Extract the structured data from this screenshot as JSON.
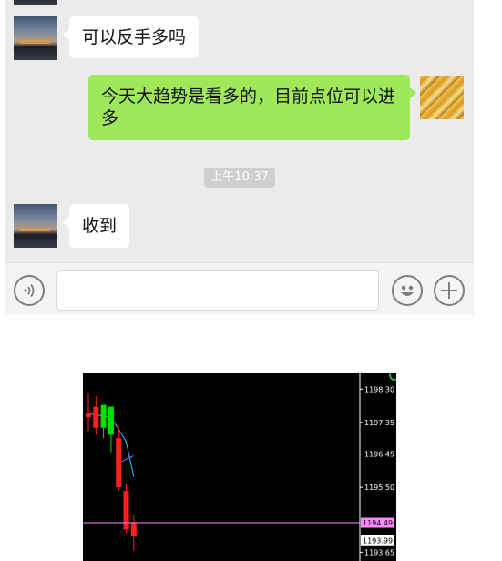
{
  "chat": {
    "messages": [
      {
        "side": "left",
        "text": "可以反手多吗"
      },
      {
        "side": "right",
        "line1": "今天大趋势是看多的，目前点位可以进",
        "line2": "多"
      },
      {
        "side": "left",
        "text": "收到"
      }
    ],
    "timestamp": "上午10:37",
    "input": {
      "value": "",
      "placeholder": ""
    }
  },
  "colors": {
    "chat_bg": "#ebebeb",
    "bubble_me": "#9ee85a",
    "bubble_other": "#ffffff",
    "bull_candle": "#00e000",
    "bear_candle": "#ff1f1f",
    "current_price_line": "#ff88ff"
  },
  "icons": {
    "voice": "voice-icon",
    "emoji": "emoji-icon",
    "plus": "plus-icon"
  },
  "chart_data": {
    "type": "candlestick",
    "y_range": [
      1193.4,
      1198.75
    ],
    "price_ticks": [
      "1198.30",
      "1197.35",
      "1196.45",
      "1195.50",
      "1193.65"
    ],
    "current_price": "1194.49",
    "bid_label": "1193.99",
    "candles": [
      {
        "o": 1197.6,
        "h": 1198.2,
        "l": 1197.1,
        "c": 1197.5
      },
      {
        "o": 1197.8,
        "h": 1198.1,
        "l": 1197.0,
        "c": 1197.2
      },
      {
        "o": 1197.2,
        "h": 1197.7,
        "l": 1196.9,
        "c": 1197.85
      },
      {
        "o": 1197.0,
        "h": 1197.4,
        "l": 1196.5,
        "c": 1197.8
      },
      {
        "o": 1196.9,
        "h": 1197.2,
        "l": 1195.4,
        "c": 1195.5
      },
      {
        "o": 1195.4,
        "h": 1195.6,
        "l": 1194.2,
        "c": 1194.3
      },
      {
        "o": 1194.5,
        "h": 1194.7,
        "l": 1193.7,
        "c": 1194.1
      }
    ],
    "ma_cyan": [
      [
        0,
        1197.6
      ],
      [
        3,
        1197.5
      ],
      [
        5,
        1196.8
      ],
      [
        6,
        1195.8
      ]
    ],
    "ma_purple": [
      [
        4,
        1196.2
      ],
      [
        6,
        1196.4
      ]
    ]
  }
}
